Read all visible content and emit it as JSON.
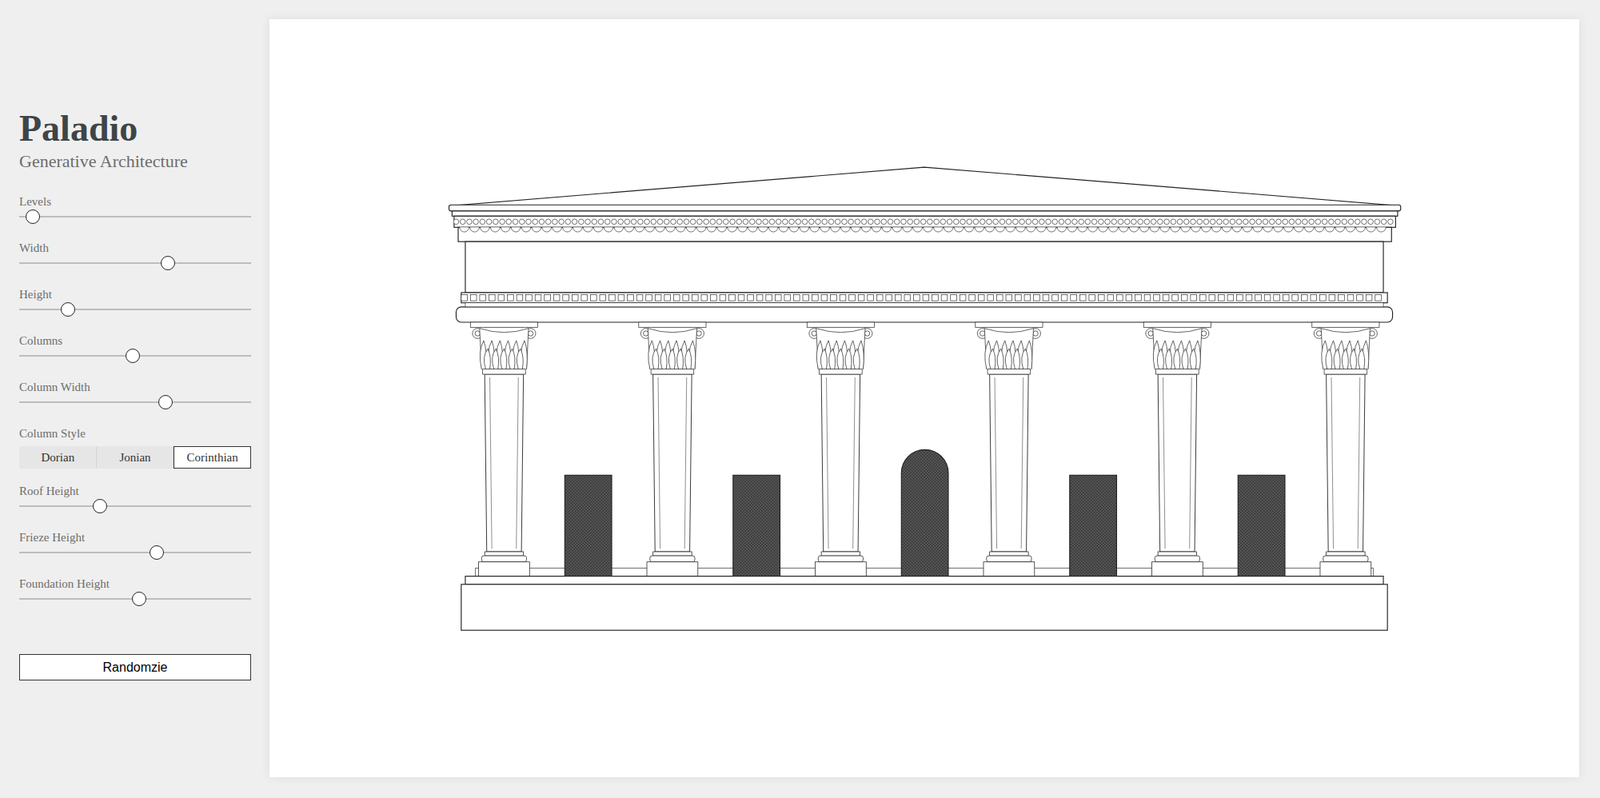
{
  "app": {
    "title": "Paladio",
    "subtitle": "Generative Architecture"
  },
  "sliders": [
    {
      "label": "Levels",
      "level": 0.03
    },
    {
      "label": "Width",
      "level": 0.65
    },
    {
      "label": "Height",
      "level": 0.19
    },
    {
      "label": "Columns",
      "level": 0.49
    },
    {
      "label": "Column Width",
      "level": 0.64
    }
  ],
  "column_style": {
    "label": "Column Style",
    "options": [
      {
        "label": "Dorian",
        "selected": false
      },
      {
        "label": "Jonian",
        "selected": false
      },
      {
        "label": "Corinthian",
        "selected": true
      }
    ]
  },
  "sliders_after": [
    {
      "label": "Roof Height",
      "level": 0.34
    },
    {
      "label": "Frieze Height",
      "level": 0.6
    },
    {
      "label": "Foundation Height",
      "level": 0.52
    }
  ],
  "button": "Randomzie",
  "temple": {
    "columns": 6,
    "doors": [
      {
        "kind": "rect"
      },
      {
        "kind": "rect"
      },
      {
        "kind": "arch"
      },
      {
        "kind": "rect"
      },
      {
        "kind": "rect"
      }
    ]
  }
}
